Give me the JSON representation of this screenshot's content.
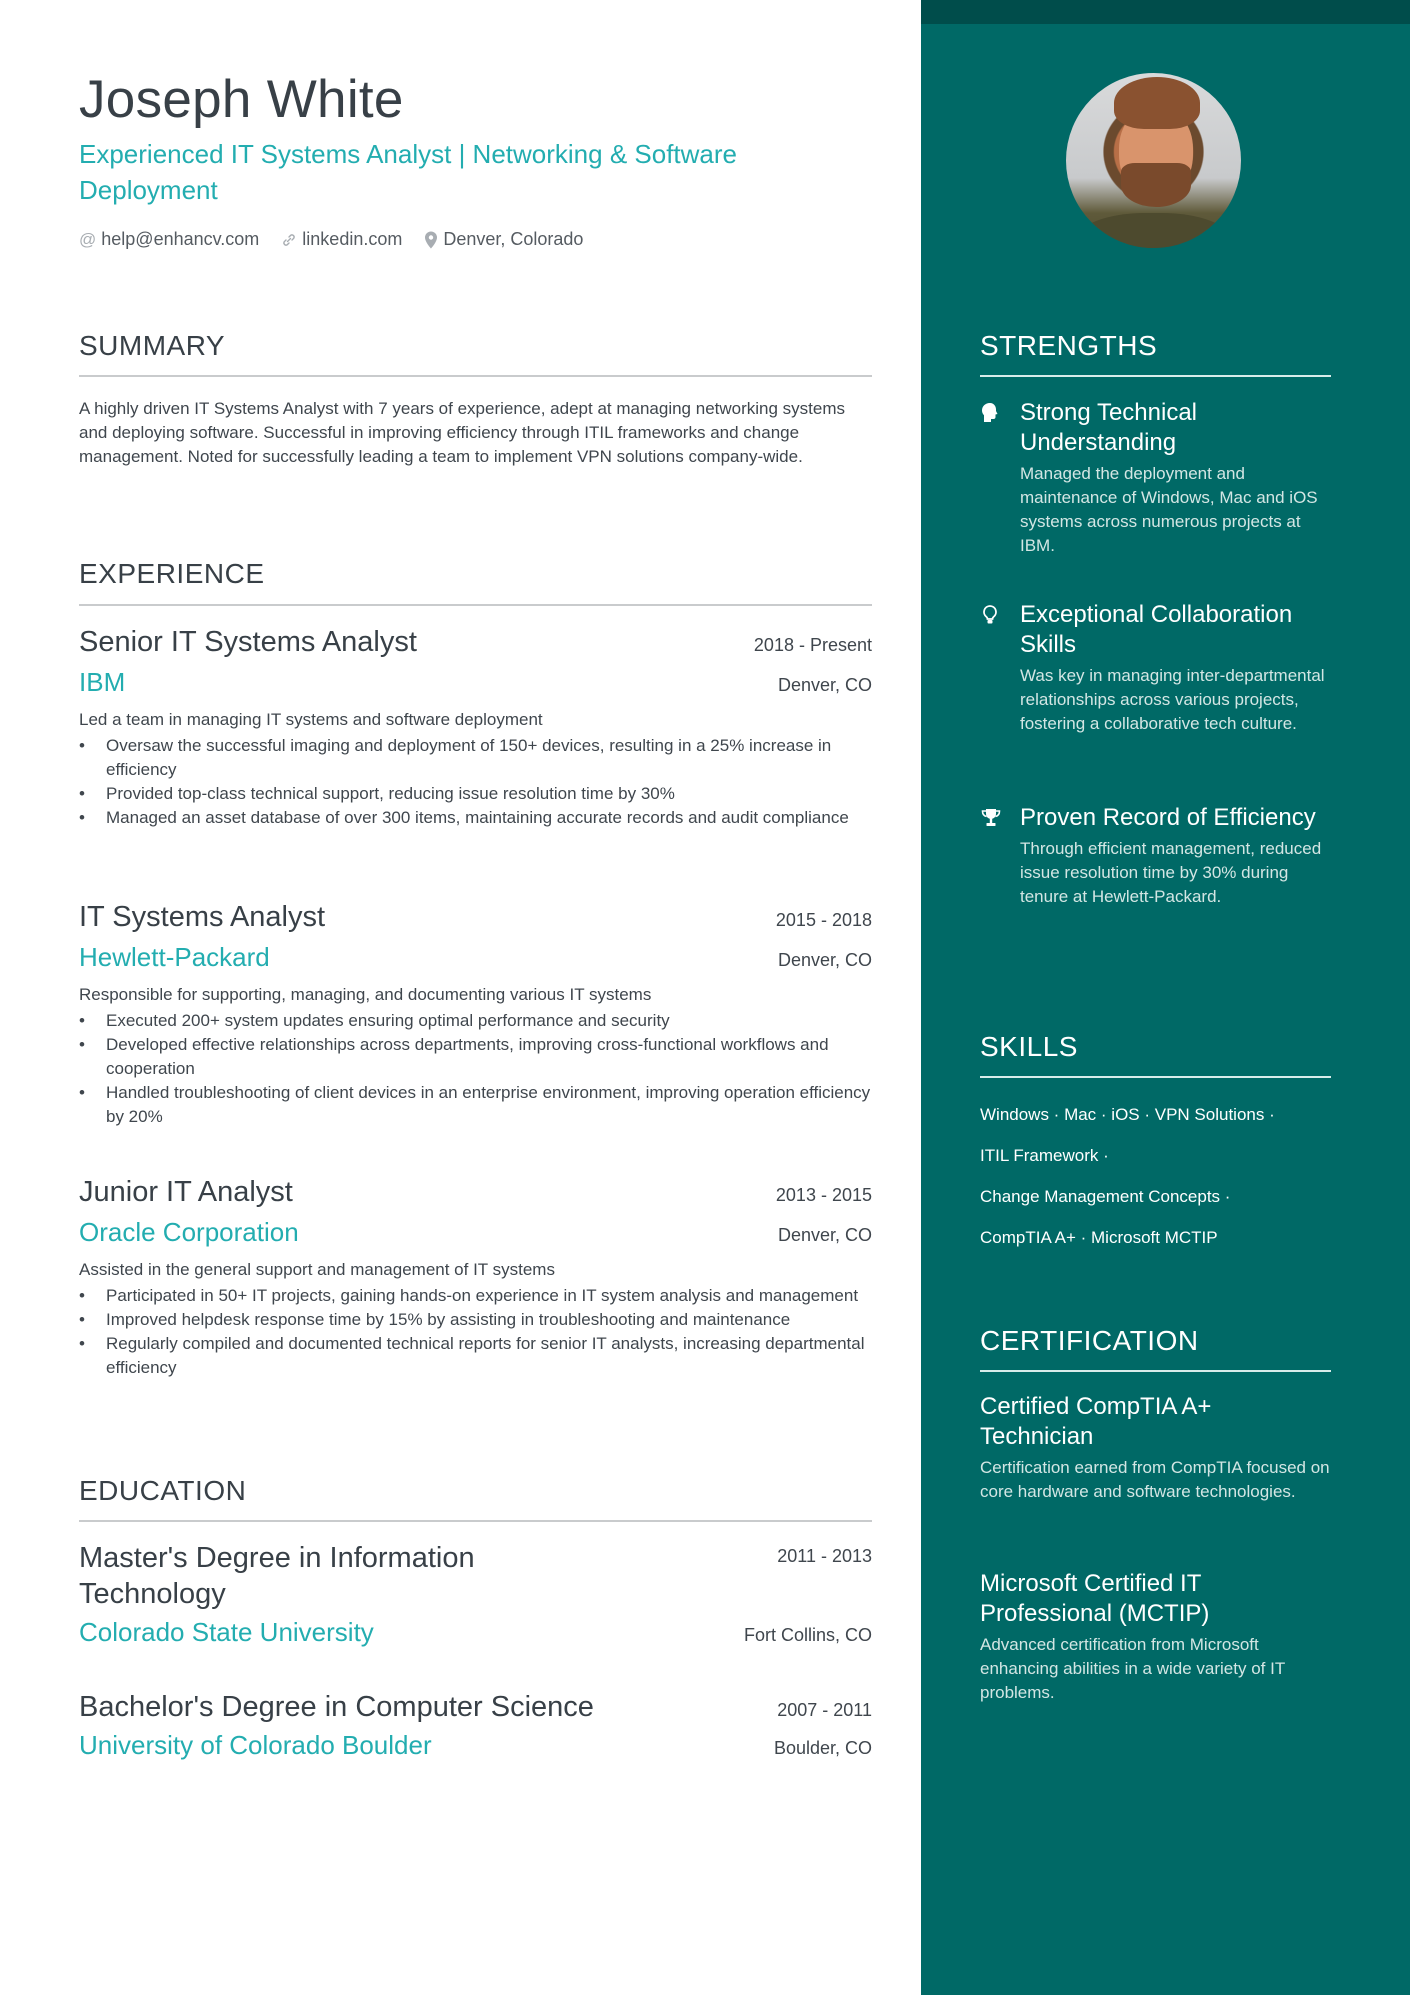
{
  "header": {
    "name": "Joseph White",
    "headline": "Experienced IT Systems Analyst | Networking & Software Deployment",
    "contacts": [
      {
        "icon": "at-icon",
        "glyph": "@",
        "text": "help@enhancv.com"
      },
      {
        "icon": "link-icon",
        "glyph": "🔗",
        "text": "linkedin.com"
      },
      {
        "icon": "location-pin-icon",
        "glyph": "📍",
        "text": "Denver, Colorado"
      }
    ]
  },
  "summary": {
    "title": "SUMMARY",
    "text": "A highly driven IT Systems Analyst with 7 years of experience, adept at managing networking systems and deploying software. Successful in improving efficiency through ITIL frameworks and change management. Noted for successfully leading a team to implement VPN solutions company-wide."
  },
  "experience": {
    "title": "EXPERIENCE",
    "items": [
      {
        "role": "Senior IT Systems Analyst",
        "dates": "2018 - Present",
        "company": "IBM",
        "location": "Denver, CO",
        "description": "Led a team in managing IT systems and software deployment",
        "bullets": [
          "Oversaw the successful imaging and deployment of 150+ devices, resulting in a 25% increase in efficiency",
          "Provided top-class technical support, reducing issue resolution time by 30%",
          "Managed an asset database of over 300 items, maintaining accurate records and audit compliance"
        ]
      },
      {
        "role": "IT Systems Analyst",
        "dates": "2015 - 2018",
        "company": "Hewlett-Packard",
        "location": "Denver, CO",
        "description": "Responsible for supporting, managing, and documenting various IT systems",
        "bullets": [
          "Executed 200+ system updates ensuring optimal performance and security",
          "Developed effective relationships across departments, improving cross-functional workflows and cooperation",
          "Handled troubleshooting of client devices in an enterprise environment, improving operation efficiency by 20%"
        ]
      },
      {
        "role": "Junior IT Analyst",
        "dates": "2013 - 2015",
        "company": "Oracle Corporation",
        "location": "Denver, CO",
        "description": "Assisted in the general support and management of IT systems",
        "bullets": [
          "Participated in 50+ IT projects, gaining hands-on experience in IT system analysis and management",
          "Improved helpdesk response time by 15% by assisting in troubleshooting and maintenance",
          "Regularly compiled and documented technical reports for senior IT analysts, increasing departmental efficiency"
        ]
      }
    ]
  },
  "education": {
    "title": "EDUCATION",
    "items": [
      {
        "degree": "Master's Degree in Information Technology",
        "dates": "2011 - 2013",
        "school": "Colorado State University",
        "location": "Fort Collins, CO"
      },
      {
        "degree": "Bachelor's Degree in Computer Science",
        "dates": "2007 - 2011",
        "school": "University of Colorado Boulder",
        "location": "Boulder, CO"
      }
    ]
  },
  "sidebar": {
    "photo_alt": "Profile photo of Joseph White",
    "strengths": {
      "title": "STRENGTHS",
      "items": [
        {
          "icon": "brain-head-icon",
          "title": "Strong Technical Understanding",
          "text": "Managed the deployment and maintenance of Windows, Mac and iOS systems across numerous projects at IBM."
        },
        {
          "icon": "lightbulb-icon",
          "title": "Exceptional Collaboration Skills",
          "text": "Was key in managing inter-departmental relationships across various projects, fostering a collaborative tech culture."
        },
        {
          "icon": "trophy-icon",
          "title": "Proven Record of Efficiency",
          "text": "Through efficient management, reduced issue resolution time by 30% during tenure at Hewlett-Packard."
        }
      ]
    },
    "skills": {
      "title": "SKILLS",
      "lines": [
        "Windows · Mac · iOS · VPN Solutions ·",
        "ITIL Framework ·",
        "Change Management Concepts ·",
        "CompTIA A+ · Microsoft MCTIP"
      ]
    },
    "certification": {
      "title": "CERTIFICATION",
      "items": [
        {
          "title": "Certified CompTIA A+ Technician",
          "text": "Certification earned from CompTIA focused on core hardware and software technologies."
        },
        {
          "title": "Microsoft Certified IT Professional (MCTIP)",
          "text": "Advanced certification from Microsoft enhancing abilities in a wide variety of IT problems."
        }
      ]
    }
  },
  "colors": {
    "accent": "#23adb0",
    "sidebar": "#006966",
    "sidebar_top": "#004d4b",
    "text": "#384047"
  }
}
